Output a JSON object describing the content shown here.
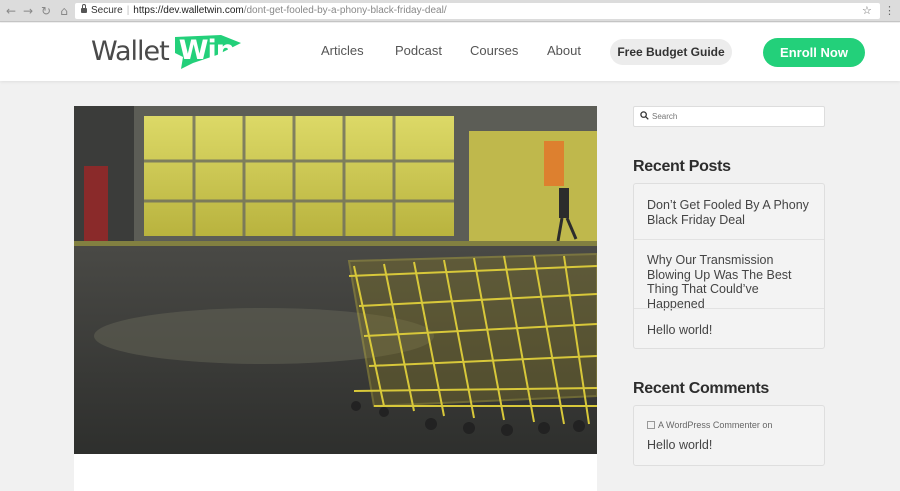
{
  "browser": {
    "secure_label": "Secure",
    "url_host": "https://dev.walletwin.com",
    "url_path": "/dont-get-fooled-by-a-phony-black-friday-deal/"
  },
  "header": {
    "logo_wallet": "Wallet",
    "logo_win": "Win",
    "nav": [
      "Articles",
      "Podcast",
      "Courses",
      "About"
    ],
    "guide_button": "Free Budget Guide",
    "enroll_button": "Enroll Now"
  },
  "sidebar": {
    "search_placeholder": "Search",
    "recent_posts_title": "Recent Posts",
    "recent_posts": [
      "Don’t Get Fooled By A Phony Black Friday Deal",
      "Why Our Transmission Blowing Up Was The Best Thing That Could’ve Happened",
      "Hello world!"
    ],
    "recent_comments_title": "Recent Comments",
    "comment_author": "A WordPress Commenter",
    "comment_on": "on",
    "comment_post": "Hello world!"
  },
  "colors": {
    "brand_green": "#23d07a",
    "text_dark": "#2d2d2d",
    "page_bg": "#f1f1f1"
  }
}
